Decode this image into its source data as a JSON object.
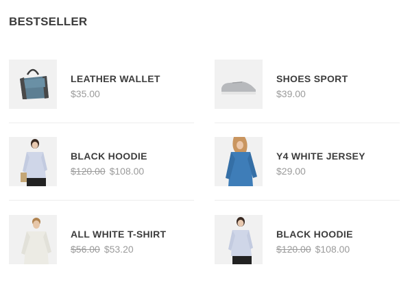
{
  "section": {
    "title": "BESTSELLER"
  },
  "products_left": [
    {
      "name": "LEATHER WALLET",
      "price": "$35.00",
      "old_price": "",
      "image": "bag-image"
    },
    {
      "name": "BLACK HOODIE",
      "price": "$108.00",
      "old_price": "$120.00",
      "image": "woman-shirt-image"
    },
    {
      "name": "ALL WHITE T-SHIRT",
      "price": "$53.20",
      "old_price": "$56.00",
      "image": "man-shirt-image"
    }
  ],
  "products_right": [
    {
      "name": "SHOES SPORT",
      "price": "$39.00",
      "old_price": "",
      "image": "sneaker-image"
    },
    {
      "name": "Y4 WHITE JERSEY",
      "price": "$29.00",
      "old_price": "",
      "image": "denim-shirt-image"
    },
    {
      "name": "BLACK HOODIE",
      "price": "$108.00",
      "old_price": "$120.00",
      "image": "woman-shirt-image"
    }
  ],
  "colors": {
    "title": "#3c3c3c",
    "price": "#9a9a9a",
    "separator": "#ececec",
    "thumb_bg": "#f1f1f1"
  }
}
